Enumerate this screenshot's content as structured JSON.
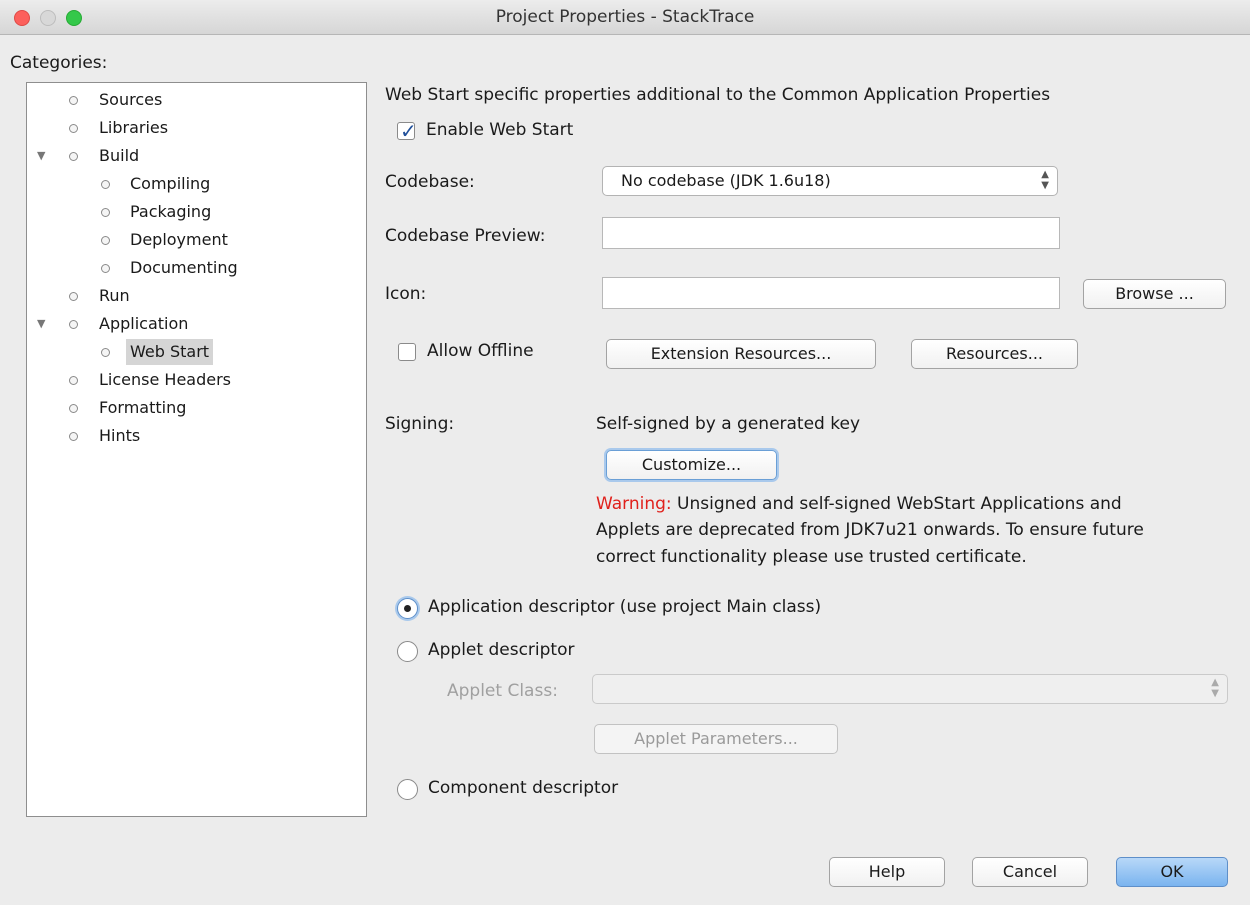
{
  "window": {
    "title": "Project Properties - StackTrace"
  },
  "categories": {
    "label": "Categories:",
    "items": [
      {
        "label": "Sources"
      },
      {
        "label": "Libraries"
      },
      {
        "label": "Build",
        "expanded": true
      },
      {
        "label": "Compiling"
      },
      {
        "label": "Packaging"
      },
      {
        "label": "Deployment"
      },
      {
        "label": "Documenting"
      },
      {
        "label": "Run"
      },
      {
        "label": "Application",
        "expanded": true
      },
      {
        "label": "Web Start",
        "selected": true
      },
      {
        "label": "License Headers"
      },
      {
        "label": "Formatting"
      },
      {
        "label": "Hints"
      }
    ]
  },
  "panel": {
    "heading": "Web Start specific properties additional to the Common Application Properties",
    "enable_web_start": {
      "label": "Enable Web Start",
      "checked": true
    },
    "codebase": {
      "label": "Codebase:",
      "value": "No codebase (JDK 1.6u18)"
    },
    "codebase_preview": {
      "label": "Codebase Preview:",
      "value": ""
    },
    "icon": {
      "label": "Icon:",
      "value": "",
      "browse_label": "Browse ..."
    },
    "allow_offline": {
      "label": "Allow Offline",
      "checked": false
    },
    "extension_resources_label": "Extension Resources...",
    "resources_label": "Resources...",
    "signing": {
      "label": "Signing:",
      "value": "Self-signed by a generated key",
      "customize_label": "Customize..."
    },
    "warning": {
      "prefix": "Warning:",
      "line1": " Unsigned and self-signed WebStart Applications and",
      "line2": "Applets are deprecated from JDK7u21 onwards. To ensure future",
      "line3": "correct functionality please use trusted certificate."
    },
    "descriptors": {
      "application": {
        "label": "Application descriptor (use project Main class)",
        "checked": true
      },
      "applet": {
        "label": "Applet descriptor",
        "checked": false
      },
      "applet_class_label": "Applet Class:",
      "applet_class_value": "",
      "applet_parameters_label": "Applet Parameters...",
      "component": {
        "label": "Component descriptor",
        "checked": false
      }
    }
  },
  "footer": {
    "help": "Help",
    "cancel": "Cancel",
    "ok": "OK"
  },
  "colors": {
    "warning": "#e0201b",
    "close": "#fc605c",
    "maximize": "#34c84a",
    "default_button": "#7ab4ef"
  }
}
